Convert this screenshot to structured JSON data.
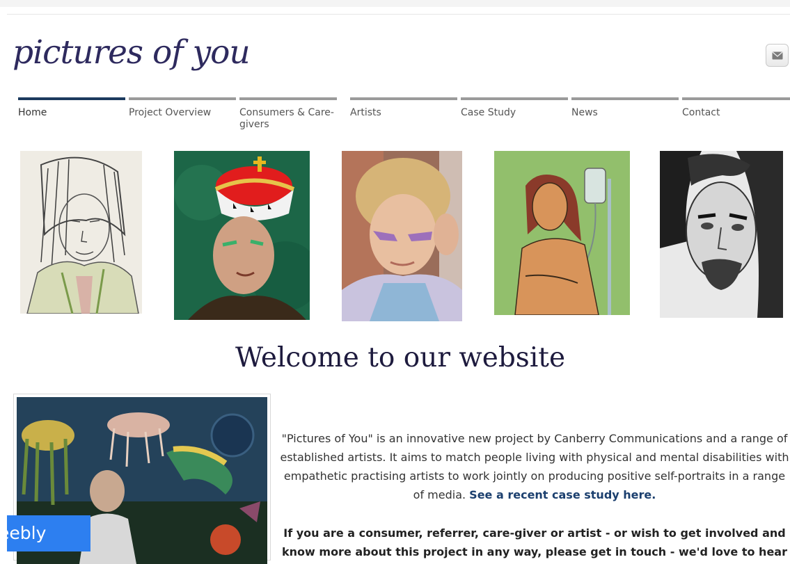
{
  "site": {
    "logo_text": "pictures of you"
  },
  "header": {
    "mail_icon": "envelope-icon"
  },
  "nav": {
    "items": [
      {
        "label": "Home",
        "active": true
      },
      {
        "label": "Project Overview",
        "active": false
      },
      {
        "label": "Consumers & Care-givers",
        "active": false
      },
      {
        "label": "Artists",
        "active": false
      },
      {
        "label": "Case Study",
        "active": false
      },
      {
        "label": "News",
        "active": false
      },
      {
        "label": "Contact",
        "active": false
      }
    ]
  },
  "main": {
    "headline": "Welcome to our website",
    "intro_text": "\"Pictures of You\" is an innovative new project by Canberry Communications and a range of established artists. It aims to match people living with physical and mental disabilities with empathetic practising artists to work jointly on producing positive self-portraits in a range of media. ",
    "case_study_link": "See a recent case study here.",
    "cta_text": "If you are a consumer, referrer, care-giver or artist - or wish to get involved and know more about this project in any way, please get in touch - we'd love to hear"
  },
  "badge": {
    "label": "eebly"
  },
  "colors": {
    "accent": "#2e2a5e",
    "nav_active": "#1c3a5e",
    "nav_inactive": "#9a9a9a",
    "link": "#1b3f6e",
    "badge": "#2d7ff0"
  }
}
